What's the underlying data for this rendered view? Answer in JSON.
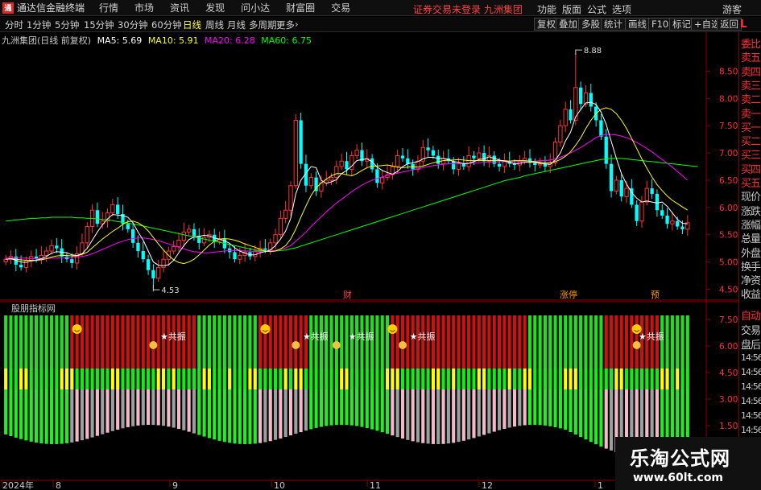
{
  "menubar": {
    "logo": "通",
    "title": "通达信金融终端",
    "menus": [
      "行情",
      "市场",
      "资讯",
      "发现",
      "问小达",
      "财富圈",
      "交易"
    ],
    "notice": "证券交易未登录  九洲集团",
    "right_menus": [
      "功能",
      "版面",
      "公式",
      "选项"
    ],
    "user": "游客",
    "window_controls": [
      "_",
      "□",
      "×"
    ]
  },
  "toolbar": {
    "periods": [
      "分时",
      "1分钟",
      "5分钟",
      "15分钟",
      "30分钟",
      "60分钟",
      "日线",
      "周线",
      "月线",
      "多周期",
      "更多"
    ],
    "active_period": "日线",
    "more_glyph": "›",
    "right_buttons": [
      "复权",
      "叠加",
      "多股",
      "统计",
      "画线",
      "F10",
      "标记",
      "+自选",
      "返回"
    ],
    "panel_toggle": "L"
  },
  "info": {
    "stock": "九洲集团(日线 前复权)",
    "ma5": "MA5: 5.69",
    "ma10": "MA10: 5.91",
    "ma20": "MA20: 6.28",
    "ma60": "MA60: 6.75"
  },
  "colors": {
    "up": "#ff3333",
    "down": "#00ffff",
    "ma5": "#ffffff",
    "ma10": "#ffff00",
    "ma20": "#ff00ff",
    "ma60": "#00ff00",
    "axis_red": "#880000"
  },
  "chart_data": {
    "type": "candlestick",
    "y_ticks": [
      "8.50",
      "8.00",
      "7.50",
      "7.00",
      "6.50",
      "6.00",
      "5.50",
      "5.00",
      "4.50"
    ],
    "ylim": [
      4.3,
      8.95
    ],
    "high_label": "8.88",
    "low_label": "4.53",
    "x_labels": [
      "2024年",
      "8",
      "9",
      "10",
      "11",
      "12",
      "1"
    ],
    "markers": [
      "财",
      "涨停",
      "预"
    ],
    "closes": [
      5.05,
      5.1,
      4.95,
      4.9,
      5.02,
      5.1,
      5.05,
      5.12,
      5.2,
      5.3,
      5.25,
      5.1,
      5.05,
      4.98,
      5.15,
      5.35,
      5.65,
      5.95,
      5.7,
      5.75,
      5.9,
      6.05,
      5.88,
      5.7,
      5.6,
      5.35,
      5.2,
      5.05,
      4.85,
      4.7,
      4.9,
      5.05,
      5.2,
      5.28,
      5.4,
      5.55,
      5.6,
      5.48,
      5.35,
      5.45,
      5.5,
      5.38,
      5.42,
      5.25,
      5.18,
      5.05,
      5.12,
      5.18,
      5.1,
      5.2,
      5.25,
      5.22,
      5.35,
      5.5,
      5.8,
      5.95,
      6.4,
      7.6,
      6.8,
      6.4,
      6.55,
      6.3,
      6.45,
      6.5,
      6.55,
      6.75,
      6.85,
      6.7,
      6.95,
      7.05,
      6.85,
      6.9,
      6.7,
      6.45,
      6.55,
      6.6,
      6.75,
      6.95,
      6.9,
      6.8,
      6.7,
      6.85,
      7.1,
      7.05,
      6.95,
      6.8,
      6.9,
      6.85,
      6.7,
      6.8,
      6.75,
      6.95,
      6.9,
      7.0,
      6.85,
      6.95,
      6.8,
      6.75,
      6.85,
      6.8,
      6.78,
      6.85,
      6.9,
      6.82,
      6.78,
      6.8,
      6.75,
      6.82,
      7.2,
      7.5,
      7.8,
      7.6,
      8.2,
      7.9,
      8.1,
      7.85,
      7.6,
      7.3,
      6.8,
      6.3,
      6.5,
      6.2,
      6.35,
      6.05,
      5.75,
      6.1,
      6.35,
      6.25,
      5.95,
      5.85,
      5.7,
      5.75,
      5.65,
      5.6,
      5.72
    ],
    "ma5": [
      5.05,
      5.06,
      5.03,
      5.0,
      4.99,
      5.02,
      5.03,
      5.06,
      5.1,
      5.16,
      5.19,
      5.18,
      5.17,
      5.13,
      5.12,
      5.15,
      5.25,
      5.4,
      5.55,
      5.68,
      5.79,
      5.87,
      5.86,
      5.85,
      5.82,
      5.72,
      5.55,
      5.4,
      5.2,
      5.0,
      4.94,
      4.93,
      4.95,
      5.03,
      5.17,
      5.3,
      5.41,
      5.46,
      5.47,
      5.49,
      5.48,
      5.44,
      5.42,
      5.39,
      5.34,
      5.26,
      5.2,
      5.16,
      5.13,
      5.13,
      5.17,
      5.19,
      5.22,
      5.3,
      5.42,
      5.57,
      5.8,
      6.25,
      6.5,
      6.63,
      6.75,
      6.73,
      6.5,
      6.44,
      6.47,
      6.51,
      6.62,
      6.68,
      6.76,
      6.86,
      6.88,
      6.89,
      6.84,
      6.74,
      6.68,
      6.64,
      6.61,
      6.66,
      6.75,
      6.8,
      6.82,
      6.84,
      6.89,
      6.92,
      6.92,
      6.9,
      6.9,
      6.88,
      6.84,
      6.83,
      6.8,
      6.81,
      6.84,
      6.88,
      6.89,
      6.93,
      6.9,
      6.87,
      6.85,
      6.83,
      6.8,
      6.81,
      6.83,
      6.83,
      6.83,
      6.81,
      6.8,
      6.79,
      6.87,
      7.0,
      7.22,
      7.38,
      7.66,
      7.8,
      7.92,
      7.93,
      7.89,
      7.75,
      7.53,
      7.21,
      6.9,
      6.62,
      6.43,
      6.28,
      6.17,
      6.1,
      6.12,
      6.1,
      6.08,
      6.1,
      6.02,
      5.9,
      5.78,
      5.71,
      5.7
    ],
    "ma10": [
      5.05,
      5.06,
      5.05,
      5.04,
      5.03,
      5.03,
      5.03,
      5.04,
      5.06,
      5.09,
      5.11,
      5.12,
      5.12,
      5.11,
      5.11,
      5.14,
      5.18,
      5.26,
      5.34,
      5.42,
      5.49,
      5.56,
      5.62,
      5.69,
      5.74,
      5.75,
      5.72,
      5.66,
      5.57,
      5.45,
      5.33,
      5.22,
      5.12,
      5.04,
      4.99,
      4.97,
      5.0,
      5.05,
      5.13,
      5.22,
      5.31,
      5.38,
      5.42,
      5.43,
      5.42,
      5.4,
      5.37,
      5.33,
      5.3,
      5.27,
      5.23,
      5.2,
      5.19,
      5.2,
      5.24,
      5.3,
      5.42,
      5.6,
      5.82,
      6.03,
      6.22,
      6.36,
      6.45,
      6.52,
      6.58,
      6.62,
      6.62,
      6.6,
      6.58,
      6.62,
      6.68,
      6.73,
      6.76,
      6.76,
      6.77,
      6.78,
      6.76,
      6.74,
      6.73,
      6.74,
      6.75,
      6.74,
      6.76,
      6.79,
      6.82,
      6.84,
      6.86,
      6.87,
      6.87,
      6.88,
      6.87,
      6.86,
      6.86,
      6.86,
      6.86,
      6.86,
      6.86,
      6.86,
      6.86,
      6.85,
      6.86,
      6.86,
      6.86,
      6.85,
      6.84,
      6.83,
      6.82,
      6.82,
      6.84,
      6.88,
      6.94,
      7.02,
      7.14,
      7.28,
      7.45,
      7.6,
      7.72,
      7.8,
      7.83,
      7.8,
      7.72,
      7.6,
      7.45,
      7.27,
      7.08,
      6.89,
      6.72,
      6.56,
      6.42,
      6.31,
      6.21,
      6.13,
      6.07,
      6.01,
      5.95
    ],
    "ma20": [
      5.08,
      5.08,
      5.08,
      5.07,
      5.07,
      5.06,
      5.06,
      5.06,
      5.06,
      5.07,
      5.07,
      5.08,
      5.08,
      5.08,
      5.09,
      5.1,
      5.12,
      5.15,
      5.19,
      5.23,
      5.27,
      5.31,
      5.35,
      5.38,
      5.41,
      5.43,
      5.44,
      5.44,
      5.43,
      5.41,
      5.39,
      5.36,
      5.33,
      5.3,
      5.27,
      5.24,
      5.21,
      5.19,
      5.18,
      5.17,
      5.17,
      5.18,
      5.19,
      5.2,
      5.21,
      5.21,
      5.21,
      5.2,
      5.2,
      5.19,
      5.19,
      5.19,
      5.2,
      5.21,
      5.23,
      5.26,
      5.3,
      5.38,
      5.46,
      5.55,
      5.65,
      5.74,
      5.83,
      5.92,
      6.0,
      6.08,
      6.15,
      6.22,
      6.29,
      6.35,
      6.41,
      6.46,
      6.5,
      6.53,
      6.56,
      6.59,
      6.61,
      6.63,
      6.65,
      6.67,
      6.69,
      6.71,
      6.73,
      6.75,
      6.77,
      6.78,
      6.79,
      6.8,
      6.8,
      6.81,
      6.81,
      6.81,
      6.82,
      6.82,
      6.83,
      6.83,
      6.83,
      6.84,
      6.84,
      6.84,
      6.84,
      6.84,
      6.85,
      6.85,
      6.85,
      6.86,
      6.86,
      6.87,
      6.89,
      6.92,
      6.96,
      7.0,
      7.05,
      7.1,
      7.16,
      7.22,
      7.28,
      7.32,
      7.34,
      7.34,
      7.33,
      7.31,
      7.28,
      7.24,
      7.19,
      7.14,
      7.08,
      7.02,
      6.95,
      6.88,
      6.81,
      6.74,
      6.66,
      6.58,
      6.5
    ],
    "ma60": [
      5.75,
      5.76,
      5.77,
      5.78,
      5.79,
      5.8,
      5.8,
      5.81,
      5.81,
      5.82,
      5.82,
      5.82,
      5.82,
      5.82,
      5.81,
      5.81,
      5.8,
      5.8,
      5.79,
      5.78,
      5.77,
      5.76,
      5.74,
      5.73,
      5.71,
      5.7,
      5.68,
      5.66,
      5.64,
      5.62,
      5.6,
      5.58,
      5.56,
      5.54,
      5.52,
      5.5,
      5.48,
      5.46,
      5.44,
      5.42,
      5.4,
      5.38,
      5.36,
      5.34,
      5.32,
      5.3,
      5.28,
      5.26,
      5.24,
      5.22,
      5.21,
      5.2,
      5.2,
      5.2,
      5.21,
      5.22,
      5.24,
      5.26,
      5.29,
      5.32,
      5.35,
      5.38,
      5.41,
      5.44,
      5.47,
      5.5,
      5.53,
      5.56,
      5.59,
      5.62,
      5.65,
      5.68,
      5.71,
      5.74,
      5.77,
      5.8,
      5.83,
      5.86,
      5.89,
      5.92,
      5.95,
      5.98,
      6.01,
      6.04,
      6.07,
      6.1,
      6.13,
      6.16,
      6.19,
      6.22,
      6.25,
      6.28,
      6.31,
      6.34,
      6.37,
      6.4,
      6.43,
      6.46,
      6.49,
      6.51,
      6.53,
      6.55,
      6.58,
      6.6,
      6.62,
      6.64,
      6.66,
      6.68,
      6.7,
      6.72,
      6.74,
      6.76,
      6.78,
      6.8,
      6.82,
      6.84,
      6.86,
      6.88,
      6.89,
      6.9,
      6.9,
      6.9,
      6.89,
      6.88,
      6.87,
      6.86,
      6.85,
      6.84,
      6.83,
      6.82,
      6.81,
      6.8,
      6.79,
      6.78,
      6.77,
      6.76,
      6.75
    ]
  },
  "indicator": {
    "title": "股朋指标网",
    "y_ticks": [
      "7.50",
      "6.00",
      "4.50",
      "3.00",
      "1.50"
    ],
    "signal_label": "★共振",
    "red_zones": [
      [
        13,
        37
      ],
      [
        50,
        59
      ],
      [
        76,
        102
      ],
      [
        118,
        128
      ],
      [
        140,
        145
      ],
      [
        165,
        180
      ]
    ],
    "smiley_at": [
      14,
      51,
      76,
      124,
      146,
      168
    ],
    "star_at": [
      31,
      59,
      68,
      80,
      125,
      148,
      170
    ],
    "money_at": [
      29,
      57,
      65,
      78,
      124,
      146,
      166
    ]
  },
  "sidepanel": {
    "labels": [
      "委比",
      "卖五",
      "卖四",
      "卖三",
      "卖二",
      "卖一",
      "买一",
      "买二",
      "买三",
      "买四",
      "买五",
      "现价",
      "涨跌",
      "涨幅",
      "总量",
      "外盘",
      "换手",
      "净资",
      "收益"
    ],
    "lower": [
      "自动",
      "交易",
      "盘后"
    ],
    "times": [
      "14:56",
      "14:56",
      "14:56",
      "14:56",
      "14:56",
      "14:56",
      "14:56"
    ]
  },
  "watermark": {
    "line1": "乐淘公式网",
    "line2": "www.60lt.com"
  }
}
